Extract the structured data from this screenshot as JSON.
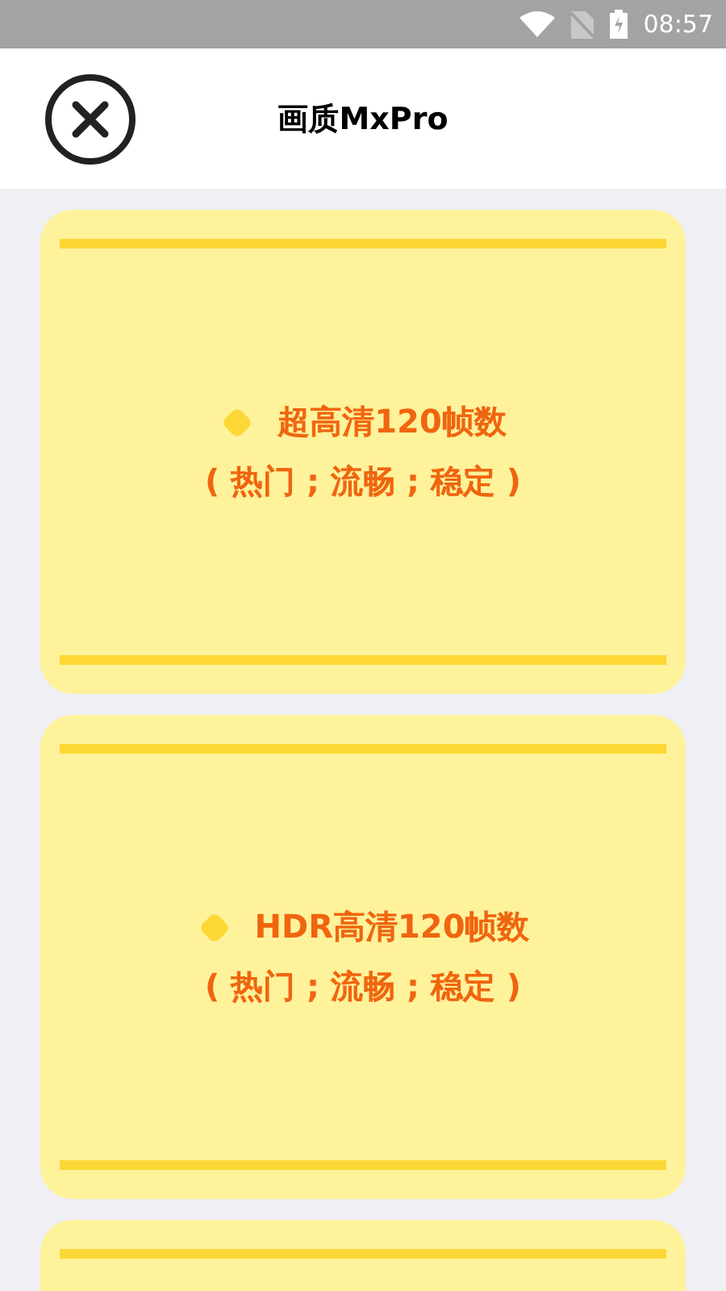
{
  "status_bar": {
    "time": "08:57"
  },
  "header": {
    "title": "画质MxPro"
  },
  "cards": [
    {
      "kind": "option",
      "title": "超高清120帧数",
      "subtitle": "( 热门 ; 流畅 ; 稳定 )"
    },
    {
      "kind": "option",
      "title": "HDR高清120帧数",
      "subtitle": "( 热门 ; 流畅 ; 稳定 )"
    },
    {
      "kind": "partial"
    }
  ]
}
